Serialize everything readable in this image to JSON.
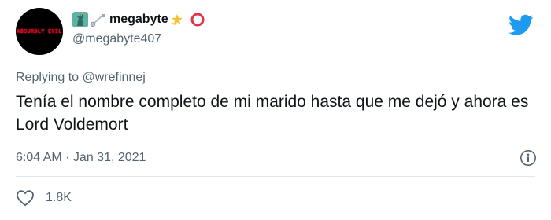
{
  "user": {
    "avatar_text": "ABSURDLY EVIL",
    "display_name": "megabyte",
    "handle": "@megabyte407",
    "name_icons": [
      "statue-of-liberty-emoji",
      "safety-pin-emoji",
      "dizzy-emoji",
      "hollow-red-circle-emoji"
    ]
  },
  "reply": {
    "prefix": "Replying to",
    "mention": "@wrefinnej"
  },
  "tweet": {
    "text": "Tenía el nombre completo de mi marido hasta que me dejó y ahora es Lord Voldemort",
    "timestamp": "6:04 AM · Jan 31, 2021"
  },
  "engagement": {
    "likes": "1.8K"
  },
  "colors": {
    "brand": "#1d9bf0",
    "secondary_text": "#536471",
    "primary_text": "#0f1419"
  }
}
